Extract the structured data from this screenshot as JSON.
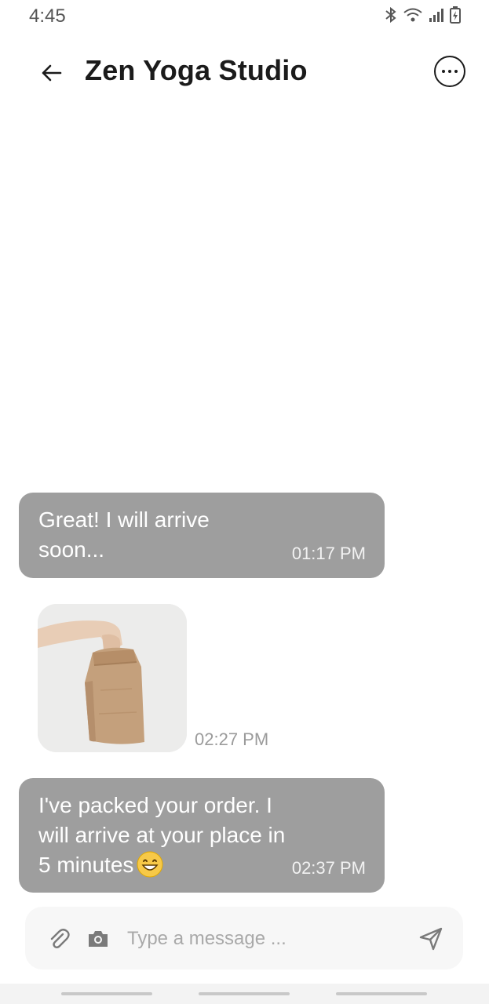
{
  "status_bar": {
    "time": "4:45",
    "icons": [
      "bluetooth-icon",
      "wifi-icon",
      "signal-icon",
      "battery-charging-icon"
    ]
  },
  "header": {
    "title": "Zen Yoga Studio",
    "back_icon": "arrow-left-icon",
    "more_icon": "more-options-icon"
  },
  "messages": [
    {
      "type": "text",
      "text": "Great! I will arrive soon...",
      "time": "01:17 PM"
    },
    {
      "type": "image",
      "image": "paper-bag-in-hand-photo",
      "time": "02:27 PM"
    },
    {
      "type": "text",
      "text": "I've packed your order. I will arrive at your place in 5 minutes",
      "emoji": "grinning-face-emoji",
      "time": "02:37 PM"
    }
  ],
  "composer": {
    "placeholder": "Type a message ...",
    "attach_icon": "paperclip-icon",
    "camera_icon": "camera-icon",
    "send_icon": "send-icon"
  },
  "colors": {
    "bubble": "#9e9e9e",
    "composer_bg": "#f7f7f7",
    "title": "#1b1b1b"
  }
}
